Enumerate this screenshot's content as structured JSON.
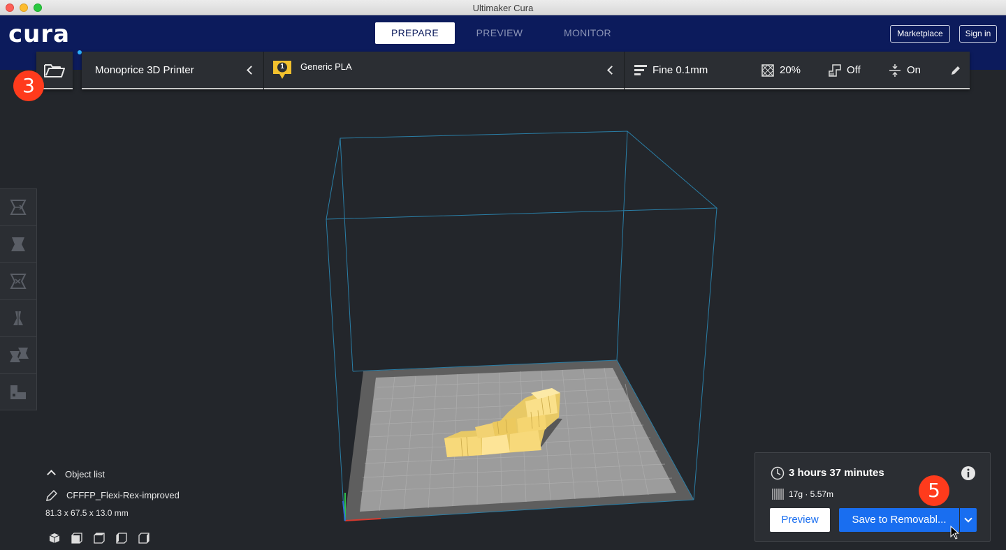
{
  "window": {
    "title": "Ultimaker Cura"
  },
  "header": {
    "logo": "cura",
    "stages": [
      {
        "label": "PREPARE",
        "active": true
      },
      {
        "label": "PREVIEW",
        "active": false
      },
      {
        "label": "MONITOR",
        "active": false
      }
    ],
    "marketplace_label": "Marketplace",
    "signin_label": "Sign in"
  },
  "toolbar": {
    "printer": "Monoprice 3D Printer",
    "extruder_number": "1",
    "material": "Generic PLA",
    "profile": "Fine 0.1mm",
    "infill": "20%",
    "support": "Off",
    "adhesion": "On"
  },
  "annotations": {
    "badge_open": "3",
    "badge_save": "5"
  },
  "object_list": {
    "label": "Object list",
    "object_name": "CFFFP_Flexi-Rex-improved",
    "dimensions": "81.3 x 67.5 x 13.0 mm"
  },
  "print_info": {
    "time": "3 hours 37 minutes",
    "material_usage": "17g · 5.57m",
    "preview_label": "Preview",
    "save_label": "Save to Removabl..."
  },
  "colors": {
    "header_bg": "#0c1b5c",
    "accent_blue": "#196ef0",
    "badge_red": "#ff3b1c",
    "model_yellow": "#f7d97a"
  }
}
